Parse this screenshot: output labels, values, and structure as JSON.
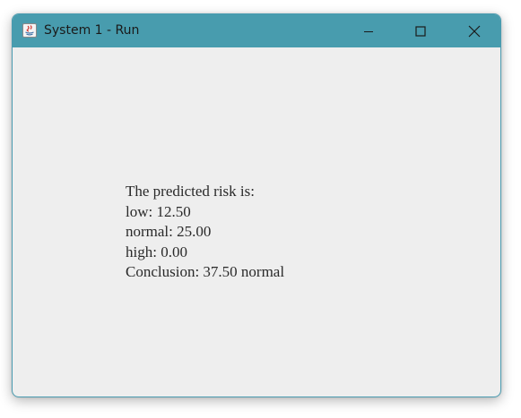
{
  "window": {
    "title": "System 1 - Run",
    "controls": {
      "minimize_icon": "minimize-icon",
      "maximize_icon": "maximize-icon",
      "close_icon": "close-icon"
    },
    "titlebar_color": "#489cae"
  },
  "result": {
    "heading": "The predicted risk is:",
    "low": "low: 12.50",
    "normal": "normal: 25.00",
    "high": "high: 0.00",
    "conclusion": "Conclusion: 37.50 normal"
  }
}
